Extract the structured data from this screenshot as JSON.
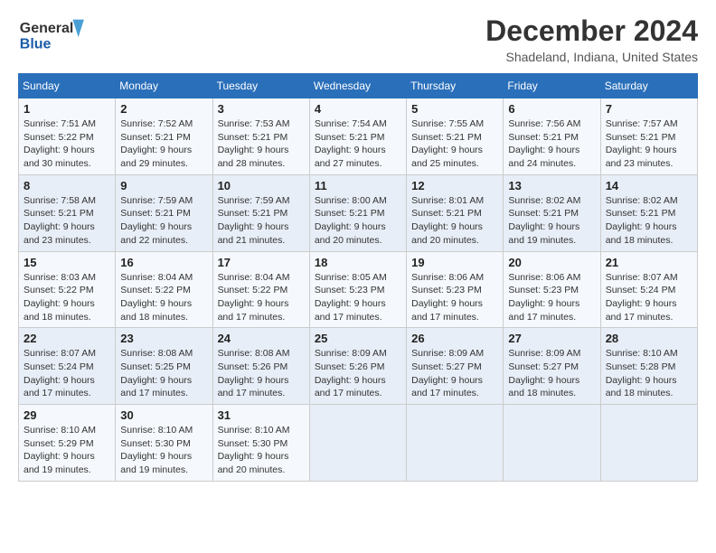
{
  "header": {
    "logo_line1": "General",
    "logo_line2": "Blue",
    "month": "December 2024",
    "location": "Shadeland, Indiana, United States"
  },
  "weekdays": [
    "Sunday",
    "Monday",
    "Tuesday",
    "Wednesday",
    "Thursday",
    "Friday",
    "Saturday"
  ],
  "weeks": [
    [
      {
        "day": "1",
        "sunrise": "7:51 AM",
        "sunset": "5:22 PM",
        "daylight": "9 hours and 30 minutes."
      },
      {
        "day": "2",
        "sunrise": "7:52 AM",
        "sunset": "5:21 PM",
        "daylight": "9 hours and 29 minutes."
      },
      {
        "day": "3",
        "sunrise": "7:53 AM",
        "sunset": "5:21 PM",
        "daylight": "9 hours and 28 minutes."
      },
      {
        "day": "4",
        "sunrise": "7:54 AM",
        "sunset": "5:21 PM",
        "daylight": "9 hours and 27 minutes."
      },
      {
        "day": "5",
        "sunrise": "7:55 AM",
        "sunset": "5:21 PM",
        "daylight": "9 hours and 25 minutes."
      },
      {
        "day": "6",
        "sunrise": "7:56 AM",
        "sunset": "5:21 PM",
        "daylight": "9 hours and 24 minutes."
      },
      {
        "day": "7",
        "sunrise": "7:57 AM",
        "sunset": "5:21 PM",
        "daylight": "9 hours and 23 minutes."
      }
    ],
    [
      {
        "day": "8",
        "sunrise": "7:58 AM",
        "sunset": "5:21 PM",
        "daylight": "9 hours and 23 minutes."
      },
      {
        "day": "9",
        "sunrise": "7:59 AM",
        "sunset": "5:21 PM",
        "daylight": "9 hours and 22 minutes."
      },
      {
        "day": "10",
        "sunrise": "7:59 AM",
        "sunset": "5:21 PM",
        "daylight": "9 hours and 21 minutes."
      },
      {
        "day": "11",
        "sunrise": "8:00 AM",
        "sunset": "5:21 PM",
        "daylight": "9 hours and 20 minutes."
      },
      {
        "day": "12",
        "sunrise": "8:01 AM",
        "sunset": "5:21 PM",
        "daylight": "9 hours and 20 minutes."
      },
      {
        "day": "13",
        "sunrise": "8:02 AM",
        "sunset": "5:21 PM",
        "daylight": "9 hours and 19 minutes."
      },
      {
        "day": "14",
        "sunrise": "8:02 AM",
        "sunset": "5:21 PM",
        "daylight": "9 hours and 18 minutes."
      }
    ],
    [
      {
        "day": "15",
        "sunrise": "8:03 AM",
        "sunset": "5:22 PM",
        "daylight": "9 hours and 18 minutes."
      },
      {
        "day": "16",
        "sunrise": "8:04 AM",
        "sunset": "5:22 PM",
        "daylight": "9 hours and 18 minutes."
      },
      {
        "day": "17",
        "sunrise": "8:04 AM",
        "sunset": "5:22 PM",
        "daylight": "9 hours and 17 minutes."
      },
      {
        "day": "18",
        "sunrise": "8:05 AM",
        "sunset": "5:23 PM",
        "daylight": "9 hours and 17 minutes."
      },
      {
        "day": "19",
        "sunrise": "8:06 AM",
        "sunset": "5:23 PM",
        "daylight": "9 hours and 17 minutes."
      },
      {
        "day": "20",
        "sunrise": "8:06 AM",
        "sunset": "5:23 PM",
        "daylight": "9 hours and 17 minutes."
      },
      {
        "day": "21",
        "sunrise": "8:07 AM",
        "sunset": "5:24 PM",
        "daylight": "9 hours and 17 minutes."
      }
    ],
    [
      {
        "day": "22",
        "sunrise": "8:07 AM",
        "sunset": "5:24 PM",
        "daylight": "9 hours and 17 minutes."
      },
      {
        "day": "23",
        "sunrise": "8:08 AM",
        "sunset": "5:25 PM",
        "daylight": "9 hours and 17 minutes."
      },
      {
        "day": "24",
        "sunrise": "8:08 AM",
        "sunset": "5:26 PM",
        "daylight": "9 hours and 17 minutes."
      },
      {
        "day": "25",
        "sunrise": "8:09 AM",
        "sunset": "5:26 PM",
        "daylight": "9 hours and 17 minutes."
      },
      {
        "day": "26",
        "sunrise": "8:09 AM",
        "sunset": "5:27 PM",
        "daylight": "9 hours and 17 minutes."
      },
      {
        "day": "27",
        "sunrise": "8:09 AM",
        "sunset": "5:27 PM",
        "daylight": "9 hours and 18 minutes."
      },
      {
        "day": "28",
        "sunrise": "8:10 AM",
        "sunset": "5:28 PM",
        "daylight": "9 hours and 18 minutes."
      }
    ],
    [
      {
        "day": "29",
        "sunrise": "8:10 AM",
        "sunset": "5:29 PM",
        "daylight": "9 hours and 19 minutes."
      },
      {
        "day": "30",
        "sunrise": "8:10 AM",
        "sunset": "5:30 PM",
        "daylight": "9 hours and 19 minutes."
      },
      {
        "day": "31",
        "sunrise": "8:10 AM",
        "sunset": "5:30 PM",
        "daylight": "9 hours and 20 minutes."
      },
      null,
      null,
      null,
      null
    ]
  ]
}
